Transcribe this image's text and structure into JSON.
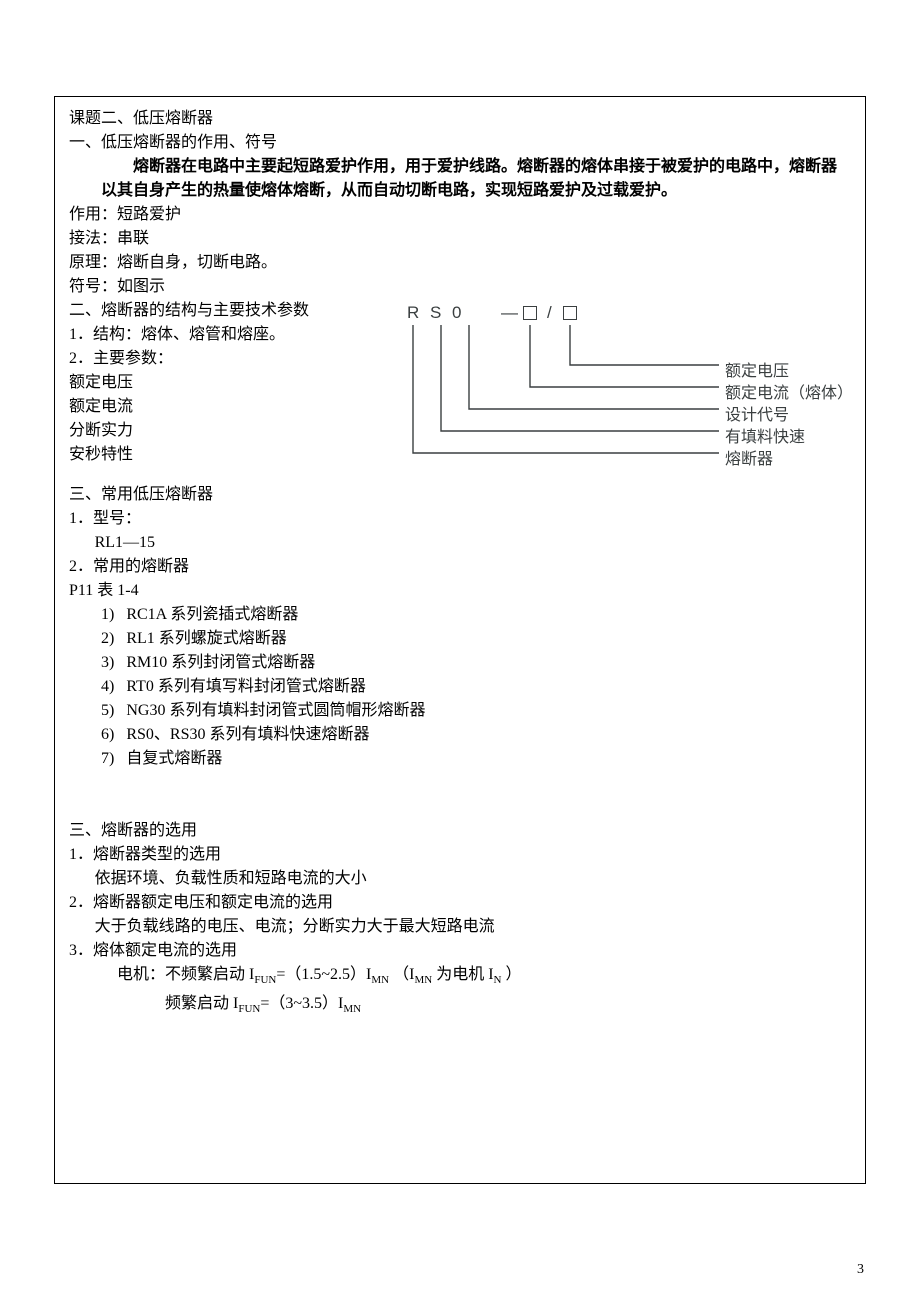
{
  "title": "课题二、低压熔断器",
  "sec1_heading": "一、低压熔断器的作用、符号",
  "intro_bold": "熔断器在电路中主要起短路爱护作用，用于爱护线路。熔断器的熔体串接于被爱护的电路中，熔断器以其自身产生的热量使熔体熔断，从而自动切断电路，实现短路爱护及过载爱护。",
  "role_label": "作用：",
  "role_value": "短路爱护",
  "conn_label": "接法：",
  "conn_value": "串联",
  "prin_label": "原理：",
  "prin_value": "熔断自身，切断电路。",
  "sym_label": "符号：",
  "sym_value": "如图示",
  "sec2_heading": "二、熔断器的结构与主要技术参数",
  "sec2_1": "1．结构：熔体、熔管和熔座。",
  "sec2_2": "2．主要参数：",
  "param1": "额定电压",
  "param2": "额定电流",
  "param3": "分断实力",
  "param4": "安秒特性",
  "diagram": {
    "code_letters": "R  S  0",
    "dash": "—",
    "slash": "/",
    "labels": [
      "额定电压",
      "额定电流（熔体）",
      "设计代号",
      "有填料快速",
      "熔断器"
    ]
  },
  "sec3a_heading": "三、常用低压熔断器",
  "sec3a_1": "1．型号：",
  "sec3a_model": "RL1—15",
  "sec3a_2": "2．常用的熔断器",
  "sec3a_table": "P11 表 1-4",
  "fuse_list": [
    "RC1A 系列瓷插式熔断器",
    "RL1 系列螺旋式熔断器",
    "RM10 系列封闭管式熔断器",
    "RT0 系列有填写料封闭管式熔断器",
    "NG30 系列有填料封闭管式圆筒帽形熔断器",
    "RS0、RS30 系列有填料快速熔断器",
    "自复式熔断器"
  ],
  "sec3b_heading": "三、熔断器的选用",
  "sel1": "1．熔断器类型的选用",
  "sel1_detail": "依据环境、负载性质和短路电流的大小",
  "sel2": "2．熔断器额定电压和额定电流的选用",
  "sel2_detail": "大于负载线路的电压、电流；分断实力大于最大短路电流",
  "sel3": "3．熔体额定电流的选用",
  "sel3_line1_pre": "电机：不频繁启动 I",
  "sel3_line1_mid": "=（1.5~2.5）I",
  "sel3_line1_paren_pre": "  （I",
  "sel3_line1_paren_mid": " 为电机 I",
  "sel3_line1_paren_end": " ）",
  "sel3_line2_pre": "频繁启动   I",
  "sel3_line2_mid": "=（3~3.5）I",
  "sub_fun": "FUN",
  "sub_mn": "MN",
  "sub_n": "N",
  "page_number": "3"
}
